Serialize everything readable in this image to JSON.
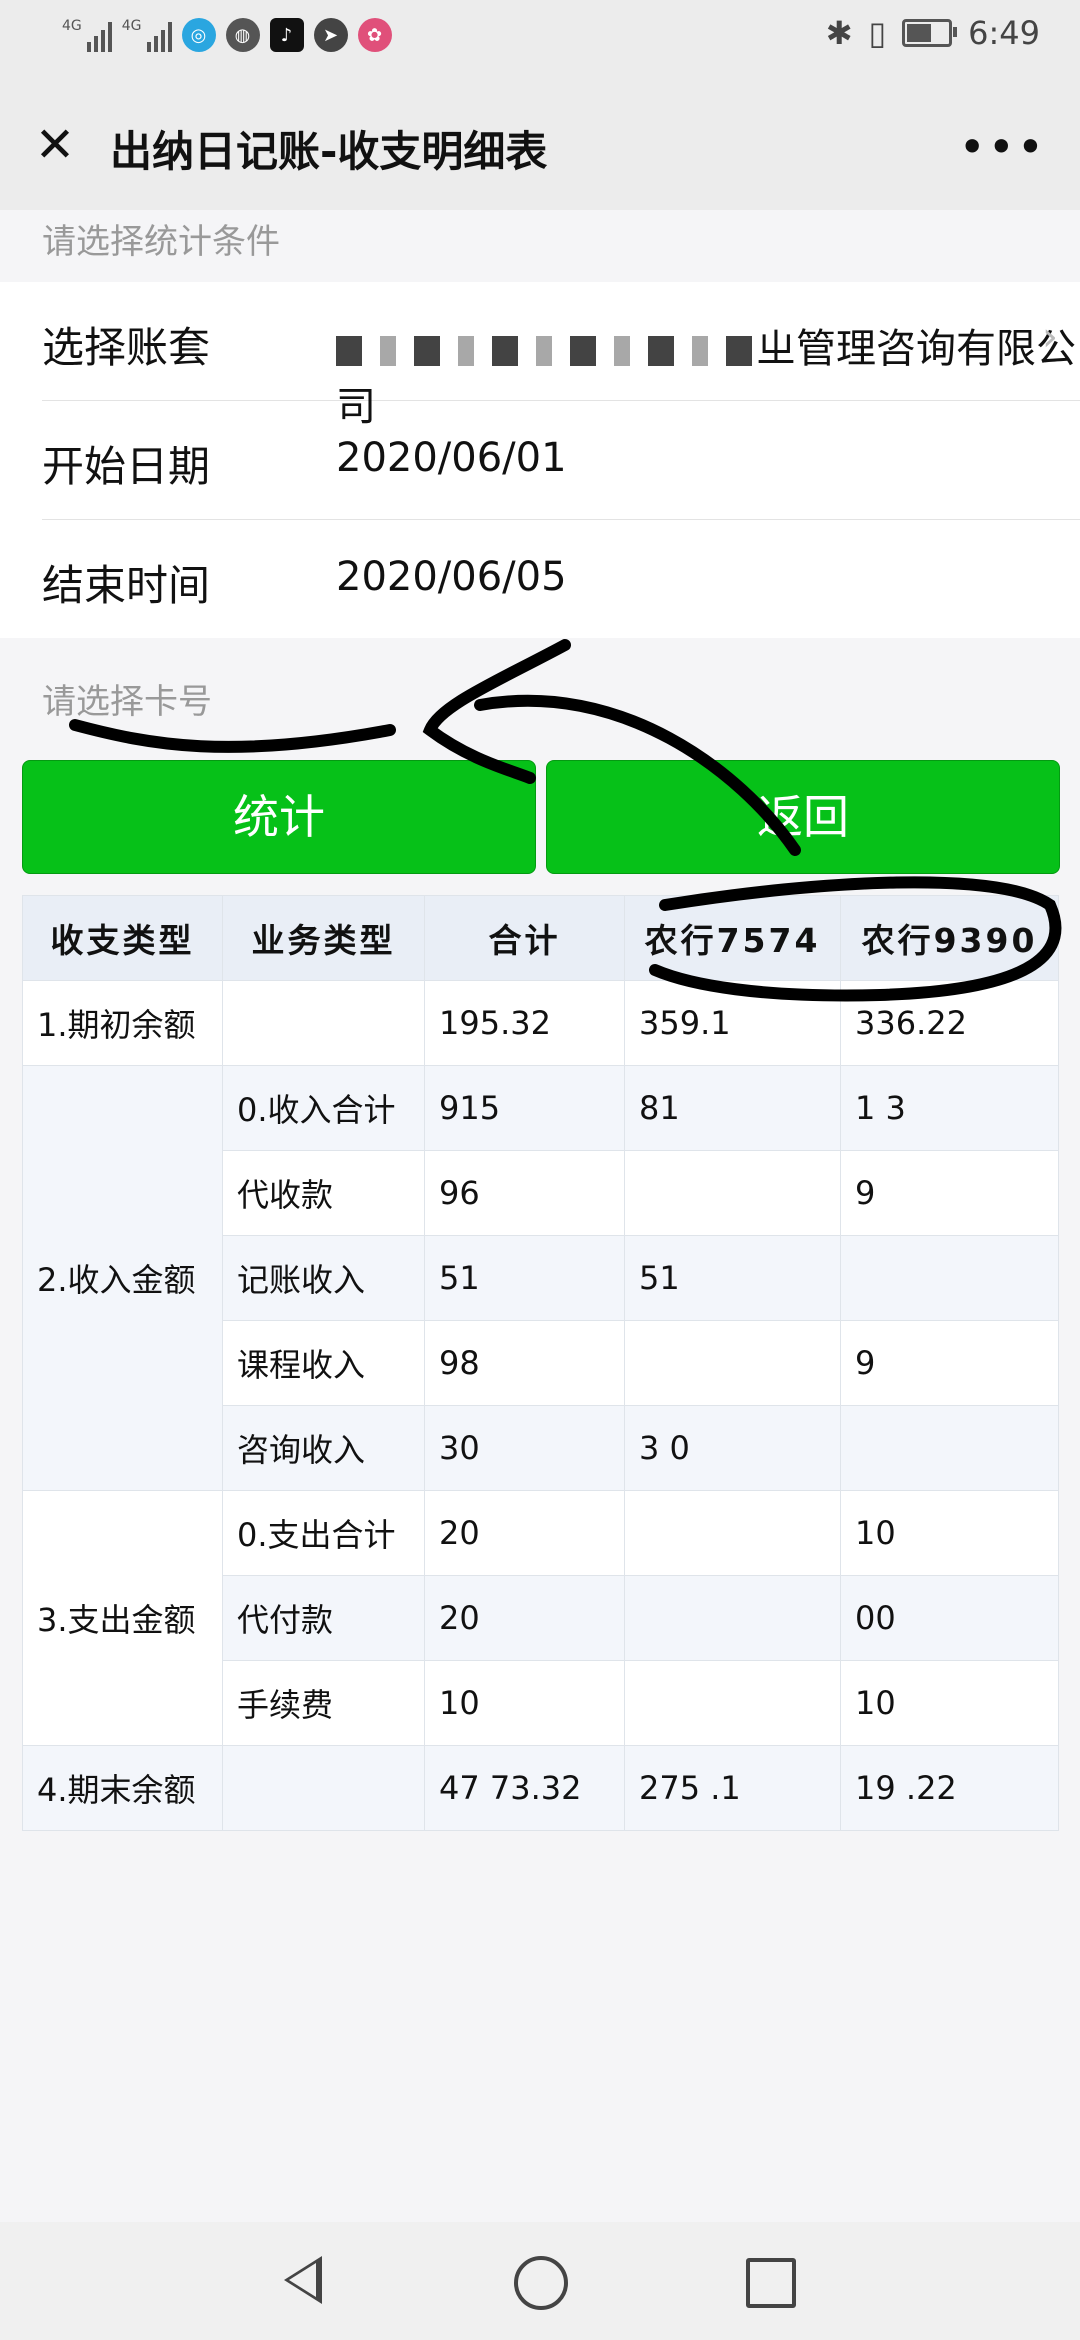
{
  "status_bar": {
    "sim1": "4G",
    "sim2": "4G",
    "time": "6:49",
    "app_icons": [
      "browser-icon",
      "wechat-icon",
      "tiktok-icon",
      "send-icon",
      "colorful-app-icon"
    ]
  },
  "header": {
    "title": "出纳日记账-收支明细表"
  },
  "conditions": {
    "hint": "请选择统计条件",
    "account_label": "选择账套",
    "account_value": "ㄓ管理咨询有限公司",
    "start_label": "开始日期",
    "start_value": "2020/06/01",
    "end_label": "结束时间",
    "end_value": "2020/06/05"
  },
  "card": {
    "hint": "请选择卡号"
  },
  "buttons": {
    "stat_label": "统计",
    "back_label": "返回"
  },
  "table": {
    "headers": [
      "收支类型",
      "业务类型",
      "合计",
      "农行7574",
      "农行9390"
    ],
    "rows": [
      {
        "group": "1.期初余额",
        "type": "",
        "total": "195.32",
        "a7574": "359.1",
        "a9390": "336.22"
      },
      {
        "group": "2.收入金额",
        "type": "0.收入合计",
        "total": "915",
        "a7574": "81",
        "a9390": "1 3"
      },
      {
        "group": "",
        "type": "代收款",
        "total": "96",
        "a7574": "",
        "a9390": "9"
      },
      {
        "group": "",
        "type": "记账收入",
        "total": "51",
        "a7574": "51",
        "a9390": ""
      },
      {
        "group": "",
        "type": "课程收入",
        "total": "98",
        "a7574": "",
        "a9390": "9"
      },
      {
        "group": "",
        "type": "咨询收入",
        "total": "30",
        "a7574": "3 0",
        "a9390": ""
      },
      {
        "group": "3.支出金额",
        "type": "0.支出合计",
        "total": "20",
        "a7574": "",
        "a9390": "10"
      },
      {
        "group": "",
        "type": "代付款",
        "total": "20",
        "a7574": "",
        "a9390": "00"
      },
      {
        "group": "",
        "type": "手续费",
        "total": "10",
        "a7574": "",
        "a9390": "10"
      },
      {
        "group": "4.期末余额",
        "type": "",
        "total": "47 73.32",
        "a7574": "275 .1",
        "a9390": "19 .22"
      }
    ]
  },
  "colors": {
    "accent_green": "#06c118",
    "header_bg": "#ececec",
    "table_header_bg": "#e9eef6"
  }
}
